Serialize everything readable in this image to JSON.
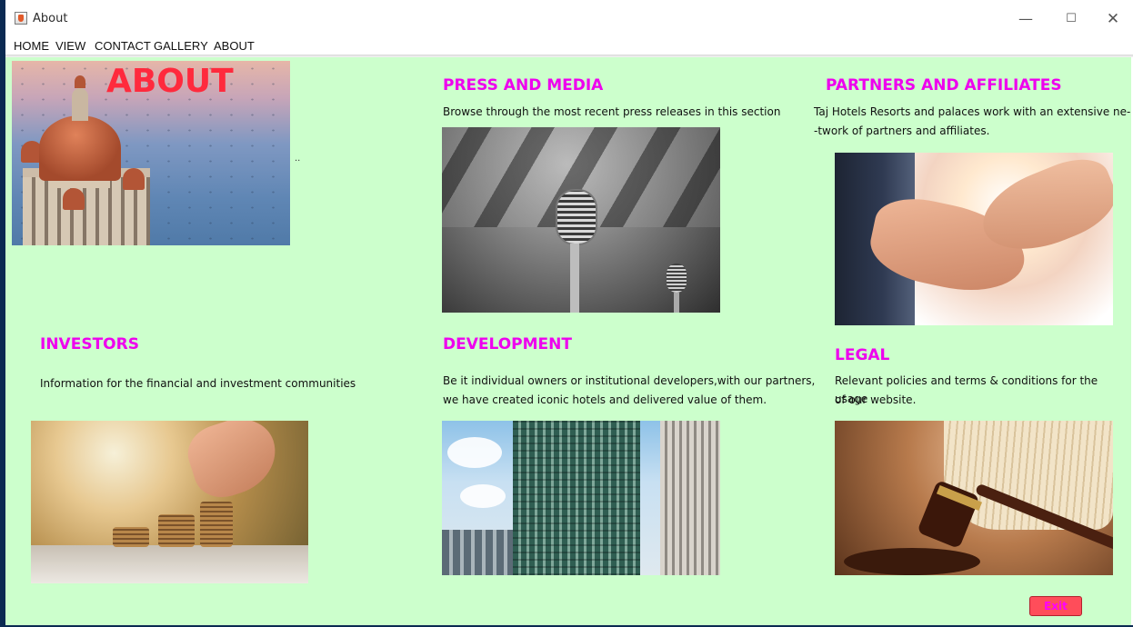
{
  "window": {
    "title": "About",
    "controls": {
      "minimize": "—",
      "maximize": "☐",
      "close": "✕"
    }
  },
  "menu": [
    "HOME",
    "VIEW",
    "CONTACT",
    "GALLERY",
    "ABOUT"
  ],
  "about": {
    "banner_text": "ABOUT",
    "mark": ".."
  },
  "sections": {
    "press": {
      "heading": "PRESS AND MEDIA",
      "text": "Browse through the most recent press releases in this section"
    },
    "partners": {
      "heading": "PARTNERS AND AFFILIATES",
      "text_line1": "Taj Hotels Resorts and palaces work with an extensive ne-",
      "text_line2": "-twork of partners and affiliates."
    },
    "investors": {
      "heading": "INVESTORS",
      "text": "Information for the financial and investment communities"
    },
    "development": {
      "heading": "DEVELOPMENT",
      "text_line1": "Be it individual owners or institutional developers,with our partners,",
      "text_line2": "we have created iconic hotels and delivered value of them."
    },
    "legal": {
      "heading": "LEGAL",
      "text_line1": "Relevant policies and terms & conditions for the usage",
      "text_line2": "of our website."
    }
  },
  "exit_button": "Exit",
  "colors": {
    "background": "#ccffcc",
    "heading": "#ee00ee",
    "about_title": "#ff2a3d",
    "exit_button": "#ff4d5a"
  }
}
